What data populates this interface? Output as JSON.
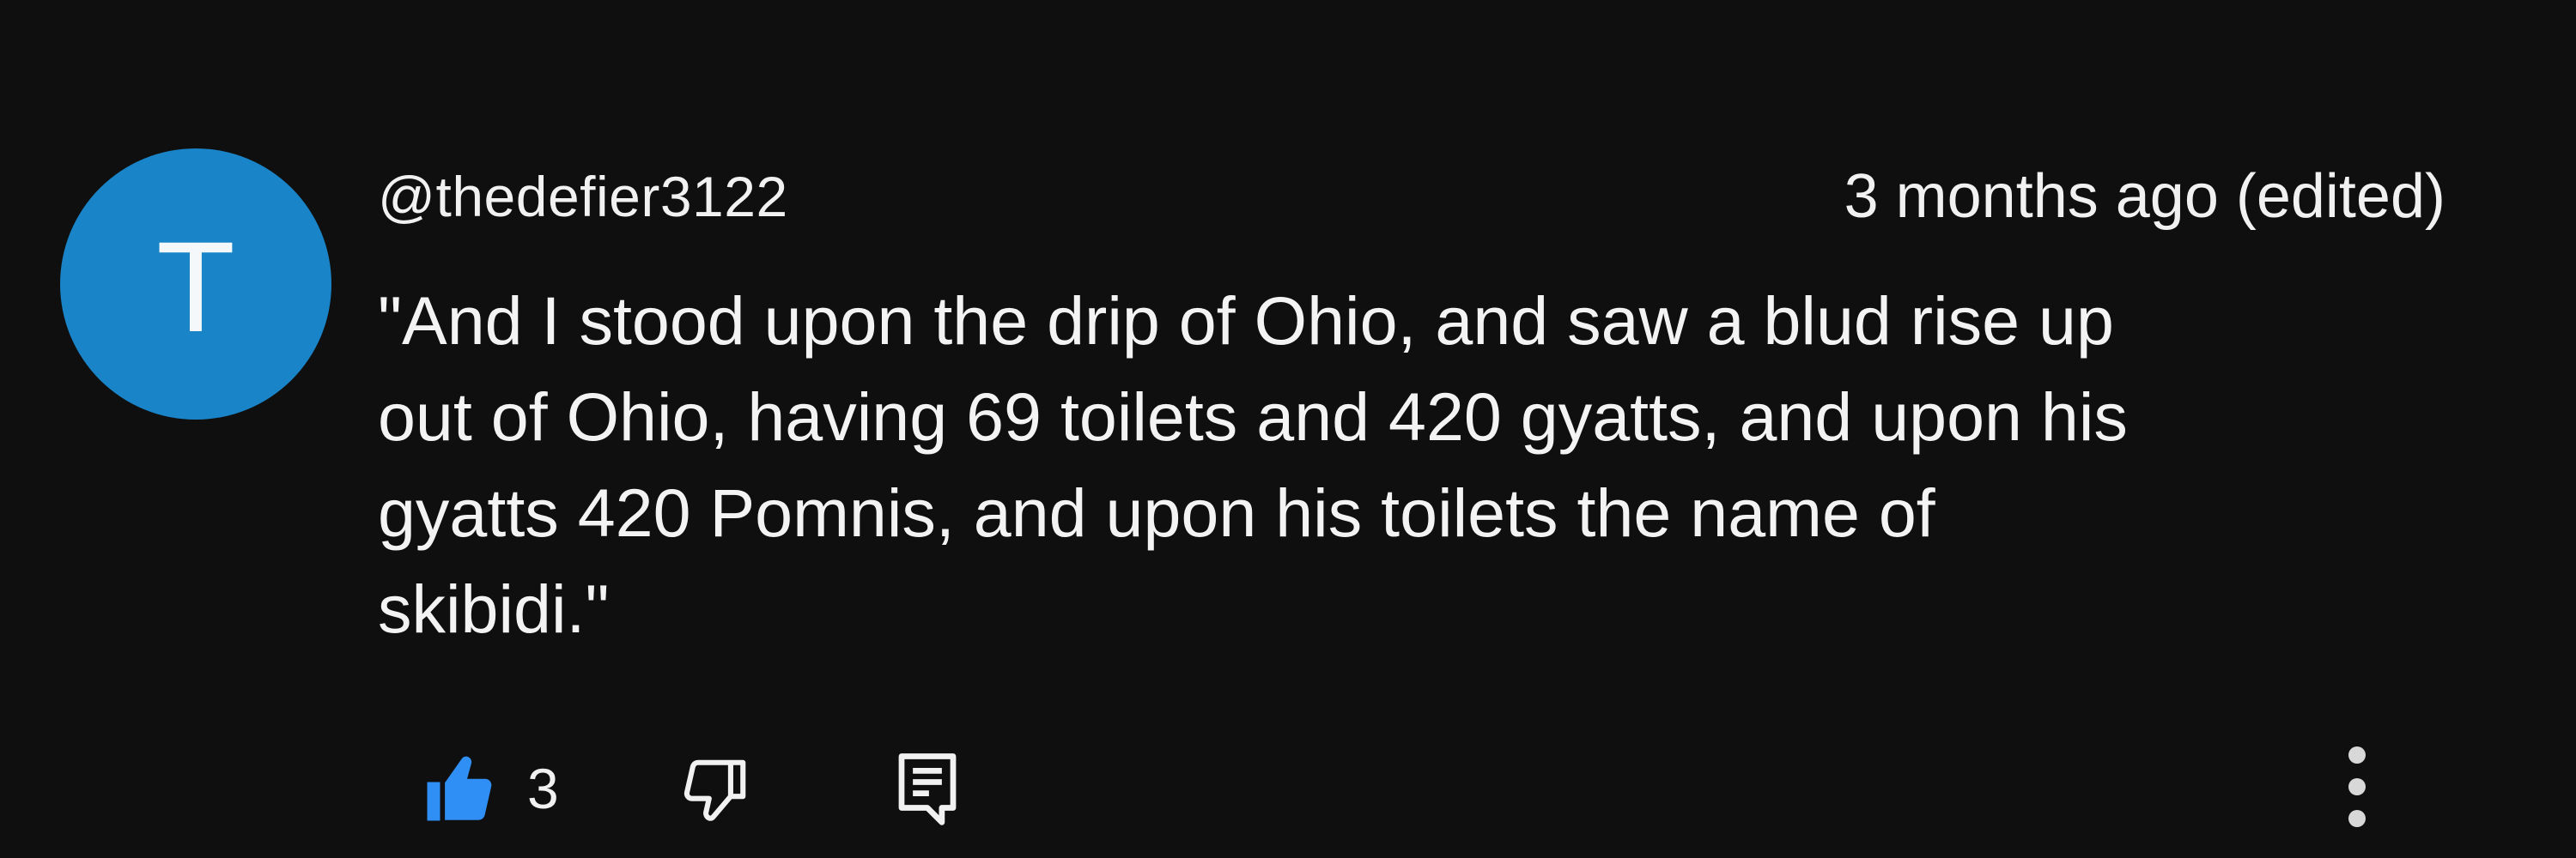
{
  "comment": {
    "avatar_letter": "T",
    "avatar_color": "#1a84c8",
    "username": "@thedefier3122",
    "timestamp": "3 months ago (edited)",
    "text": "\"And I stood upon the drip of Ohio, and saw a blud rise up\nout of Ohio, having 69 toilets and 420 gyatts, and upon his\ngyatts 420 Pomnis, and upon his toilets the name of\nskibidi.\"",
    "like_count": "3",
    "accent_color": "#2f8ff4",
    "icons": [
      "thumbs-up-icon",
      "thumbs-down-icon",
      "reply-icon",
      "more-vertical-icon"
    ]
  }
}
